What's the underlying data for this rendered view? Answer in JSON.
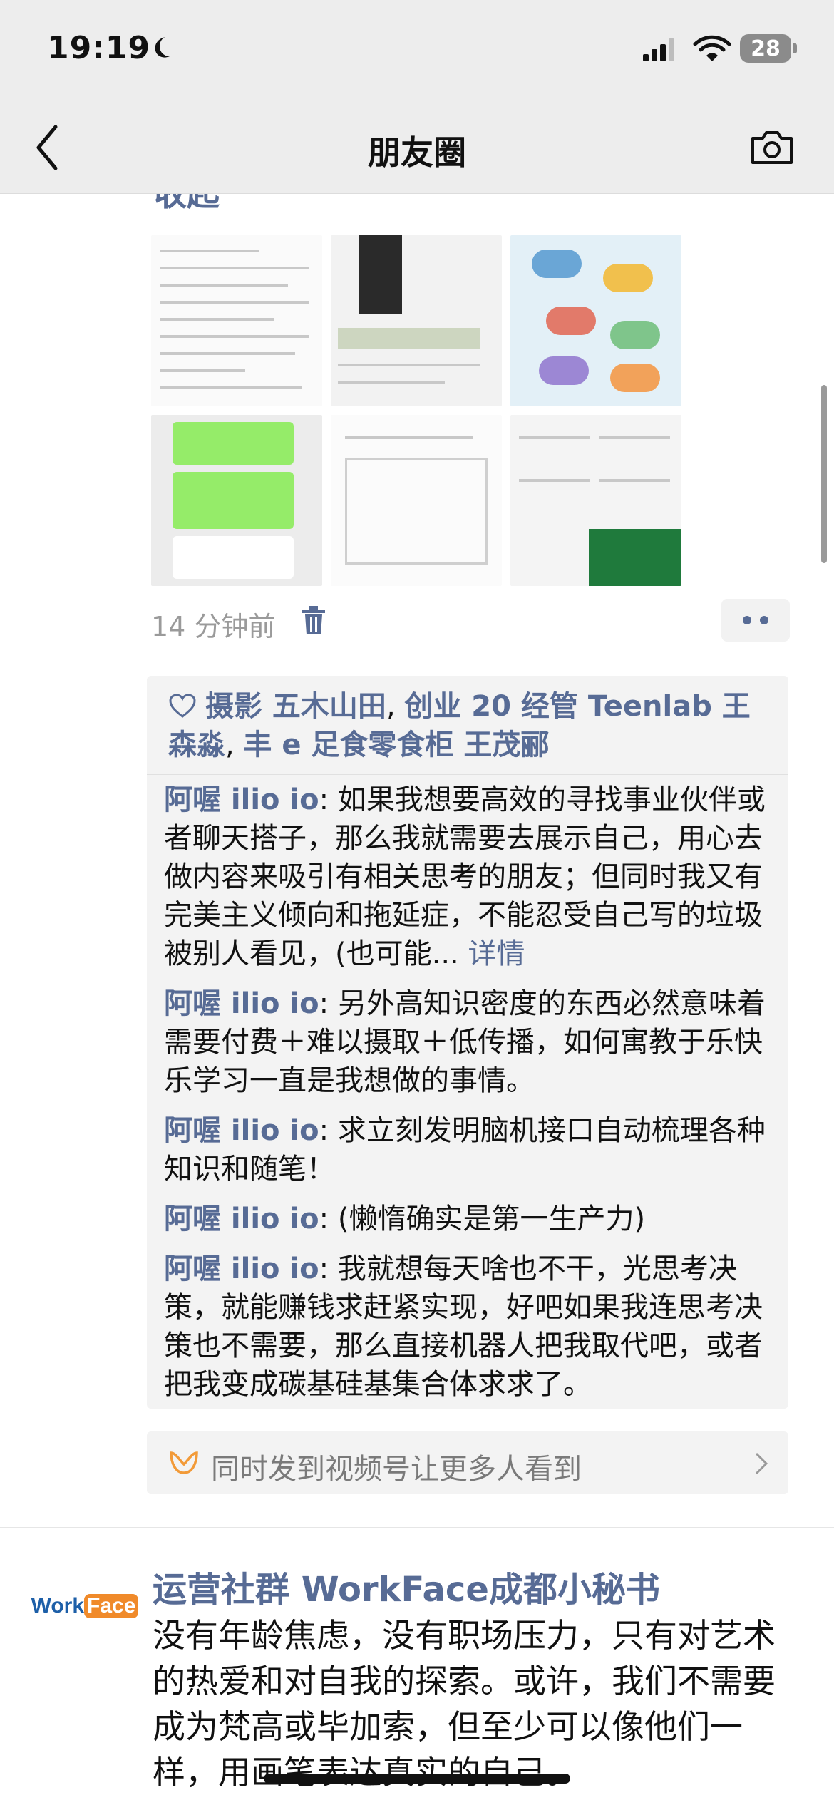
{
  "status": {
    "time": "19:19",
    "battery": "28"
  },
  "nav": {
    "title": "朋友圈"
  },
  "post1": {
    "collapse_label": "收起",
    "timestamp": "14 分钟前",
    "likes": {
      "names": [
        "摄影 五木山田",
        "创业 20 经管 Teenlab 王森淼",
        "丰 e 足食零食柜 王茂郦"
      ],
      "separator": ", "
    },
    "comments": [
      {
        "author": "阿喔 ilio io",
        "text": ": 如果我想要高效的寻找事业伙伴或者聊天搭子，那么我就需要去展示自己，用心去做内容来吸引有相关思考的朋友；但同时我又有完美主义倾向和拖延症，不能忍受自己写的垃圾被别人看见，(也可能...",
        "detail": " 详情"
      },
      {
        "author": "阿喔 ilio io",
        "text": ": 另外高知识密度的东西必然意味着需要付费＋难以摄取＋低传播，如何寓教于乐快乐学习一直是我想做的事情。"
      },
      {
        "author": "阿喔 ilio io",
        "text": ": 求立刻发明脑机接口自动梳理各种知识和随笔！"
      },
      {
        "author": "阿喔 ilio io",
        "text": ": (懒惰确实是第一生产力)"
      },
      {
        "author": "阿喔 ilio io",
        "text": ": 我就想每天啥也不干，光思考决策，就能赚钱求赶紧实现，好吧如果我连思考决策也不需要，那么直接机器人把我取代吧，或者把我变成碳基硅基集合体求求了。"
      }
    ],
    "channel_prompt": "同时发到视频号让更多人看到"
  },
  "post2": {
    "avatar_logo": {
      "part1": "Work",
      "part2": "Face"
    },
    "author": "运营社群 WorkFace成都小秘书",
    "text": "没有年龄焦虑，没有职场压力，只有对艺术的热爱和对自我的探索。或许，我们不需要成为梵高或毕加索，但至少可以像他们一样，用画笔表达真实的自己。"
  },
  "colors": {
    "link": "#576b95",
    "bar": "#ededed",
    "comment_bg": "#f3f3f3"
  },
  "icons": [
    "moon-icon",
    "signal-icon",
    "wifi-icon",
    "back-chevron-icon",
    "camera-icon",
    "trash-icon",
    "heart-icon",
    "channels-icon",
    "chevron-right-icon"
  ]
}
